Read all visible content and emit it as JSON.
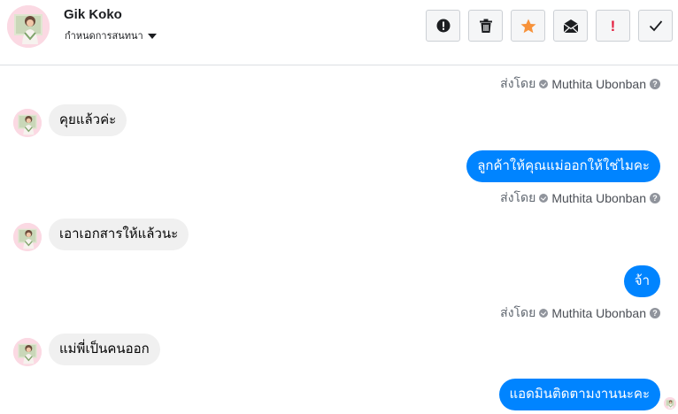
{
  "header": {
    "contact_name": "Gik Koko",
    "conversation_menu_label": "กำหนดการสนทนา",
    "toolbar": [
      {
        "icon": "exclamation-circle-icon"
      },
      {
        "icon": "trash-icon"
      },
      {
        "icon": "star-icon",
        "color": "#f7923a"
      },
      {
        "icon": "envelope-icon"
      },
      {
        "icon": "red-exclamation-icon",
        "color": "#e41e3f",
        "glyph": "!"
      },
      {
        "icon": "checkmark-icon"
      }
    ]
  },
  "messages": {
    "sent_by_prefix": "ส่งโดย",
    "agent_name": "Muthita Ubonban",
    "help_glyph": "?",
    "items": [
      {
        "direction": "outgoing",
        "text": ""
      },
      {
        "direction": "incoming",
        "text": "คุยแล้วค่ะ"
      },
      {
        "direction": "outgoing",
        "text": "ลูกค้าให้คุณแม่ออกให้ใช่ไมคะ"
      },
      {
        "direction": "incoming",
        "text": "เอาเอกสารให้แล้วนะ"
      },
      {
        "direction": "outgoing",
        "text": "จ้า"
      },
      {
        "direction": "incoming",
        "text": "แม่พี่เป็นคนออก"
      },
      {
        "direction": "outgoing",
        "text": "แอดมินติดตามงานนะคะ"
      }
    ]
  },
  "colors": {
    "outgoing_bubble": "#0084ff",
    "incoming_bubble": "#f0f0f0",
    "star": "#f7923a",
    "alert": "#e41e3f"
  }
}
